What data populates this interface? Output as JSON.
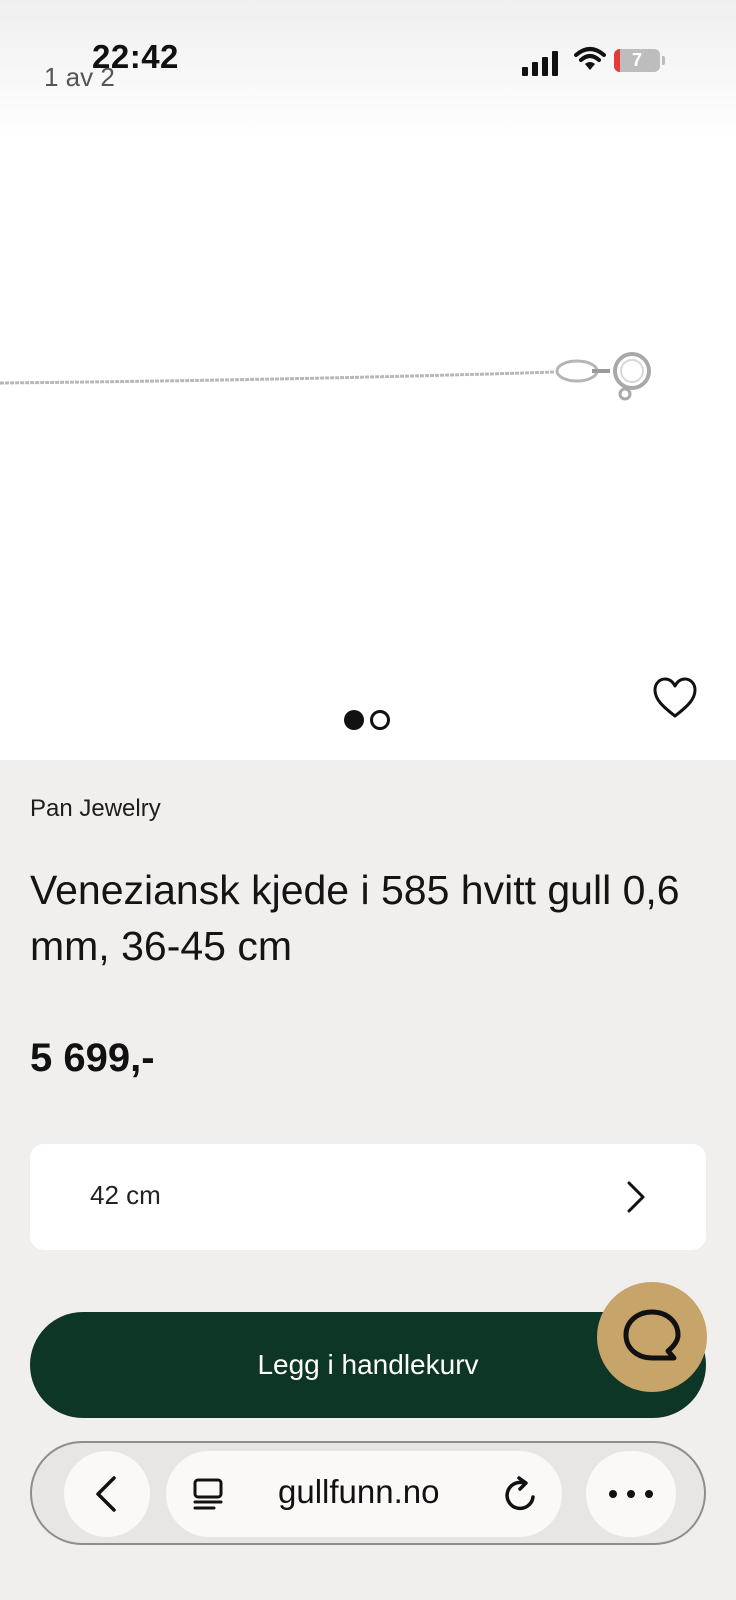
{
  "status_bar": {
    "time": "22:42",
    "battery": "7"
  },
  "gallery": {
    "counter": "1 av 2",
    "image_icon": "chain-necklace-image",
    "current_slide": 1,
    "total_slides": 2
  },
  "product": {
    "brand": "Pan Jewelry",
    "title": "Veneziansk kjede i 585 hvitt gull 0,6 mm, 36-45 cm",
    "price": "5 699,-",
    "size": "42 cm"
  },
  "actions": {
    "add_to_cart": "Legg i handlekurv"
  },
  "browser": {
    "url": "gullfunn.no"
  },
  "colors": {
    "cart_button": "#0e3626",
    "chat_button": "#c7a469",
    "page_background": "#f1efed"
  }
}
